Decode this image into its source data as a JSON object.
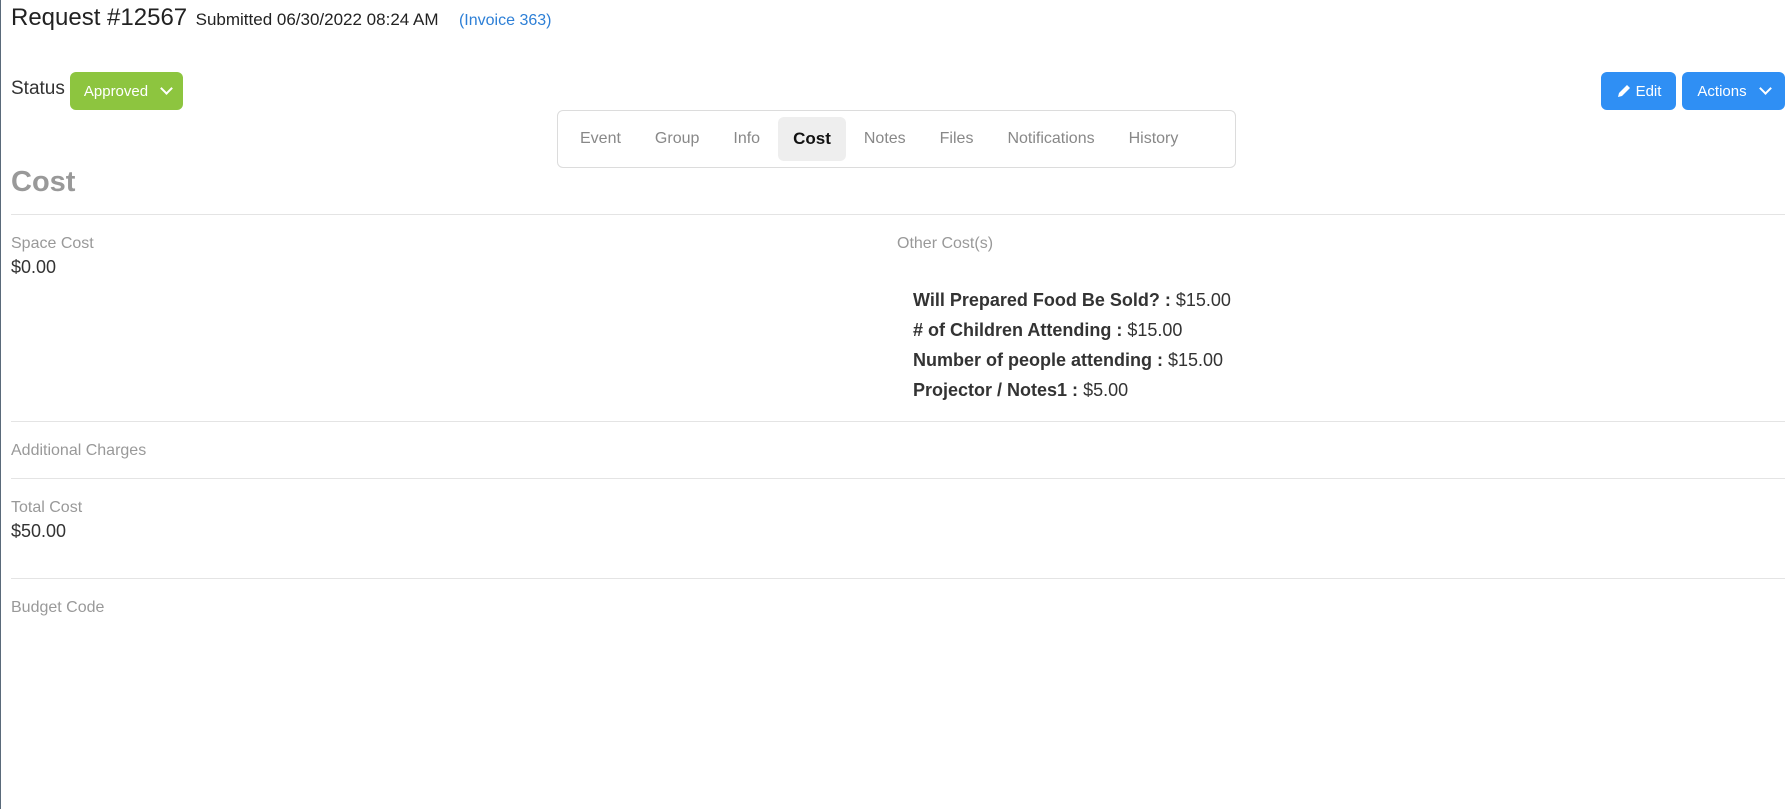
{
  "header": {
    "request_title": "Request #12567",
    "submitted": "Submitted 06/30/2022 08:24 AM",
    "invoice": "(Invoice 363)"
  },
  "status": {
    "label": "Status",
    "value": "Approved",
    "accent_color": "#8dc53f"
  },
  "tabs": [
    {
      "label": "Event",
      "active": false
    },
    {
      "label": "Group",
      "active": false
    },
    {
      "label": "Info",
      "active": false
    },
    {
      "label": "Cost",
      "active": true
    },
    {
      "label": "Notes",
      "active": false
    },
    {
      "label": "Files",
      "active": false
    },
    {
      "label": "Notifications",
      "active": false
    },
    {
      "label": "History",
      "active": false
    }
  ],
  "actions": {
    "edit_label": "Edit",
    "actions_label": "Actions",
    "button_color": "#2f8ff4"
  },
  "cost": {
    "section_title": "Cost",
    "space_cost_label": "Space Cost",
    "space_cost_value": "$0.00",
    "other_costs_label": "Other Cost(s)",
    "other_costs": [
      {
        "name": "Will Prepared Food Be Sold? :",
        "amount": "$15.00"
      },
      {
        "name": "# of Children Attending :",
        "amount": "$15.00"
      },
      {
        "name": "Number of people attending :",
        "amount": "$15.00"
      },
      {
        "name": "Projector / Notes1 :",
        "amount": "$5.00"
      }
    ],
    "additional_charges_label": "Additional Charges",
    "total_cost_label": "Total Cost",
    "total_cost_value": "$50.00",
    "budget_code_label": "Budget Code"
  }
}
